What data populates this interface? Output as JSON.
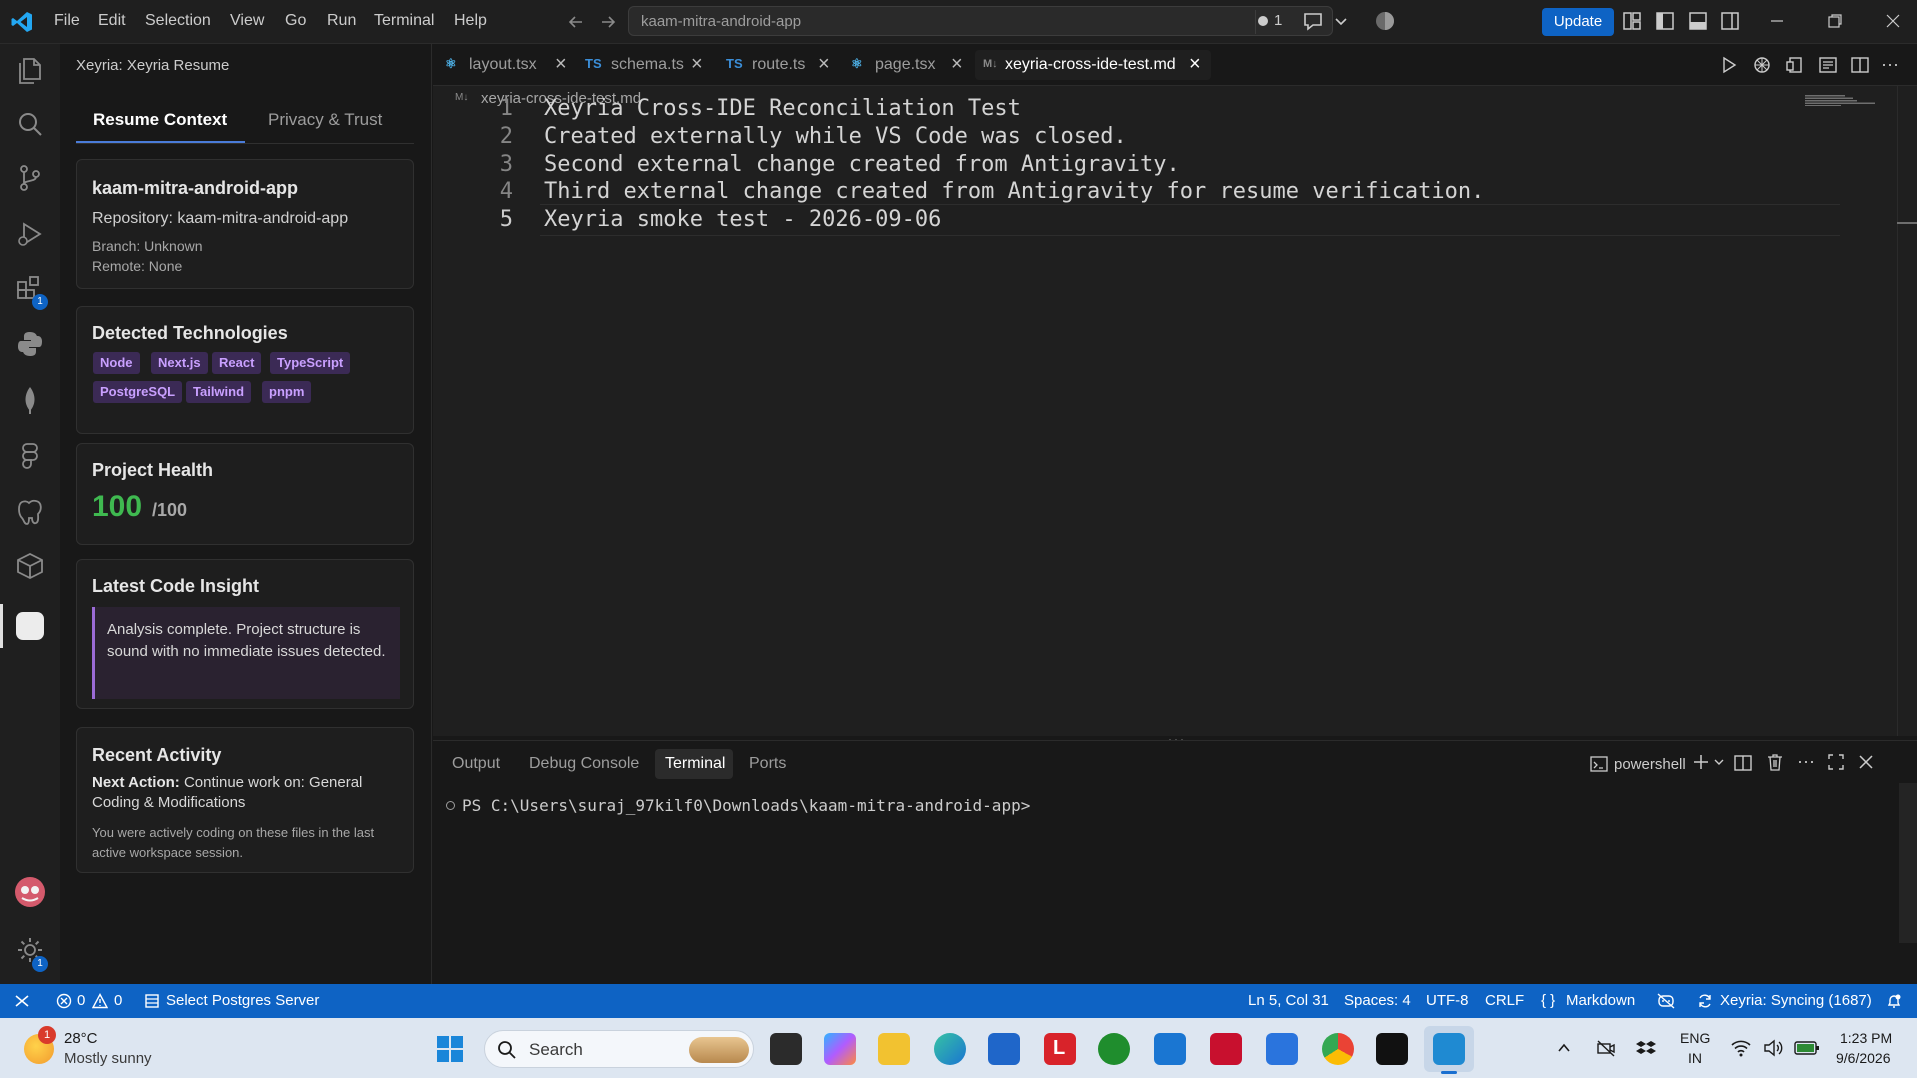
{
  "titlebar": {
    "menu": [
      "File",
      "Edit",
      "Selection",
      "View",
      "Go",
      "Run",
      "Terminal",
      "Help"
    ],
    "command_center": "kaam-mitra-android-app",
    "problems_dot_count": "1",
    "update_label": "Update"
  },
  "activity_badges": {
    "extensions": "1",
    "settings": "1"
  },
  "sidebar": {
    "header": "Xeyria: Xeyria Resume",
    "tabs": [
      "Resume Context",
      "Privacy & Trust"
    ],
    "repo": {
      "name": "kaam-mitra-android-app",
      "repository_line": "Repository: kaam-mitra-android-app",
      "branch": "Branch: Unknown",
      "remote": "Remote: None"
    },
    "technologies": {
      "title": "Detected Technologies",
      "chips": [
        "Node",
        "Next.js",
        "React",
        "TypeScript",
        "PostgreSQL",
        "Tailwind",
        "pnpm"
      ]
    },
    "health": {
      "title": "Project Health",
      "score": "100",
      "max": "/100"
    },
    "insight": {
      "title": "Latest Code Insight",
      "text": "Analysis complete. Project structure is sound with no immediate issues detected."
    },
    "activity": {
      "title": "Recent Activity",
      "next_label": "Next Action:",
      "next_text": "Continue work on: General Coding & Modifications",
      "detail": "You were actively coding on these files in the last active workspace session."
    }
  },
  "tabs": [
    {
      "label": "layout.tsx",
      "icon": "react-icon"
    },
    {
      "label": "schema.ts",
      "icon": "typescript-icon"
    },
    {
      "label": "route.ts",
      "icon": "typescript-icon"
    },
    {
      "label": "page.tsx",
      "icon": "react-icon"
    },
    {
      "label": "xeyria-cross-ide-test.md",
      "icon": "markdown-icon"
    }
  ],
  "breadcrumb": "xeyria-cross-ide-test.md",
  "editor_lines": [
    {
      "n": "1",
      "text": "Xeyria Cross-IDE Reconciliation Test"
    },
    {
      "n": "2",
      "text": "Created externally while VS Code was closed."
    },
    {
      "n": "3",
      "text": "Second external change created from Antigravity."
    },
    {
      "n": "4",
      "text": "Third external change created from Antigravity for resume verification."
    },
    {
      "n": "5",
      "text": "Xeyria smoke test - 2026-09-06"
    }
  ],
  "panel": {
    "tabs": [
      "Output",
      "Debug Console",
      "Terminal",
      "Ports"
    ],
    "shell": "powershell",
    "prompt": "PS C:\\Users\\suraj_97kilf0\\Downloads\\kaam-mitra-android-app>"
  },
  "statusbar": {
    "errors": "0",
    "warnings": "0",
    "postgres": "Select Postgres Server",
    "position": "Ln 5, Col 31",
    "spaces": "Spaces: 4",
    "encoding": "UTF-8",
    "eol": "CRLF",
    "language": "Markdown",
    "xeyria": "Xeyria: Syncing (1687)"
  },
  "taskbar": {
    "weather_temp": "28°C",
    "weather_desc": "Mostly sunny",
    "weather_badge": "1",
    "search_label": "Search",
    "lang_top": "ENG",
    "lang_bottom": "IN",
    "time": "1:23 PM",
    "date": "9/6/2026"
  },
  "colors": {
    "accent": "#0e63c4",
    "health": "#3fb950",
    "chip_text": "#c9a0ff"
  }
}
